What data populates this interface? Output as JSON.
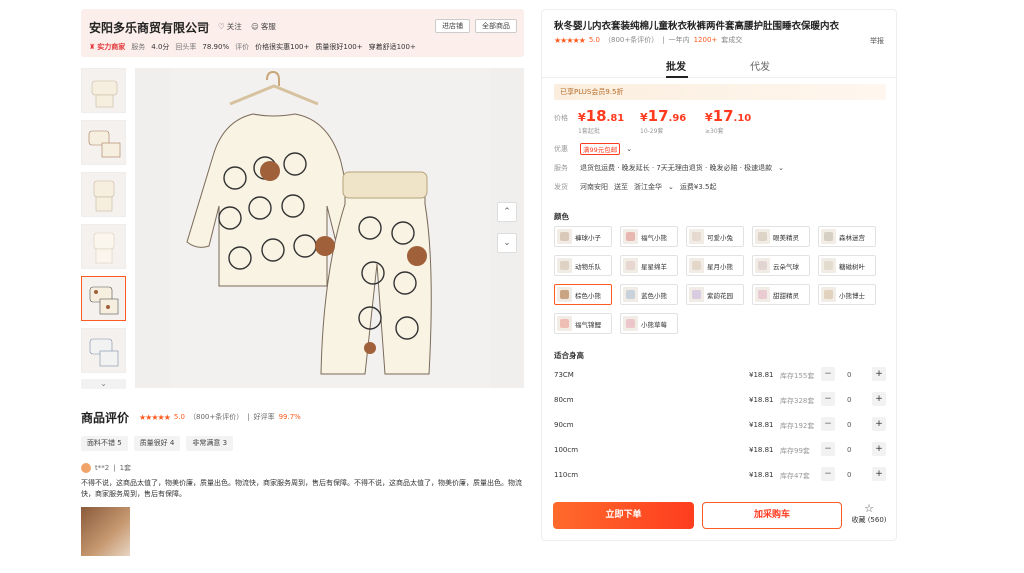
{
  "shop": {
    "name": "安阳多乐商贸有限公司",
    "follow_label": "关注",
    "cs_label": "客服",
    "enter_store": "进店铺",
    "all_products": "全部商品",
    "badge": "实力商家",
    "stats": [
      {
        "label": "服务",
        "value": "4.0分"
      },
      {
        "label": "回头率",
        "value": "78.90%"
      },
      {
        "label": "评价",
        "value": "价格很实惠100+"
      },
      {
        "label": "",
        "value": "质量很好100+"
      },
      {
        "label": "",
        "value": "穿着舒适100+"
      }
    ]
  },
  "gallery": {
    "up_arrow": "⌃",
    "down_arrow": "⌄",
    "thumb_down": "⌄"
  },
  "product": {
    "title": "秋冬婴儿内衣套装纯棉儿童秋衣秋裤两件套高腰护肚围睡衣保暖内衣",
    "stars": "★★★★★",
    "rating": "5.0",
    "rating_count": "（800+条评价）",
    "sales_prefix": "一年内",
    "sales_count": "1200+",
    "sales_suffix": "套成交",
    "report": "举报"
  },
  "tabs": [
    {
      "label": "批发"
    },
    {
      "label": "代发"
    }
  ],
  "plus_banner": "已享PLUS会员9.5折",
  "price": {
    "label": "价格",
    "tiers": [
      {
        "currency": "¥",
        "int": "18",
        "dec": ".81",
        "cond": "1套起批"
      },
      {
        "currency": "¥",
        "int": "17",
        "dec": ".96",
        "cond": "10-29套"
      },
      {
        "currency": "¥",
        "int": "17",
        "dec": ".10",
        "cond": "≥30套"
      }
    ]
  },
  "promo": {
    "label": "优惠",
    "coupon": "满99元包邮",
    "chevron": "⌄"
  },
  "service": {
    "label": "服务",
    "text": "退货包运费 · 晚发延长 · 7天无理由退货 · 晚发必赔 · 极速退款",
    "chevron": "⌄"
  },
  "shipping": {
    "label": "发货",
    "from": "河南安阳",
    "to_word": "送至",
    "to": "浙江金华",
    "chevron": "⌄",
    "fee": "运费¥3.5起"
  },
  "colors": {
    "label": "颜色",
    "options": [
      {
        "name": "褲球小子",
        "swatch": "#d9c9b8"
      },
      {
        "name": "福气小熊",
        "swatch": "#e8b8b0"
      },
      {
        "name": "可爱小兔",
        "swatch": "#e6d9cf"
      },
      {
        "name": "眼美精灵",
        "swatch": "#ddd3c6"
      },
      {
        "name": "森林迷宫",
        "swatch": "#d5cfc4"
      },
      {
        "name": "动物乐队",
        "swatch": "#ded2c4"
      },
      {
        "name": "星星绵羊",
        "swatch": "#e7d7d0"
      },
      {
        "name": "星月小熊",
        "swatch": "#e3d7c9"
      },
      {
        "name": "云朵气球",
        "swatch": "#e2d4d0"
      },
      {
        "name": "糖磁树叶",
        "swatch": "#e2dccf"
      },
      {
        "name": "棕色小熊",
        "swatch": "#c9a584"
      },
      {
        "name": "蓝色小熊",
        "swatch": "#c9d2da"
      },
      {
        "name": "紫韵花园",
        "swatch": "#d9cce0"
      },
      {
        "name": "甜甜精灵",
        "swatch": "#e9cbd2"
      },
      {
        "name": "小熊博士",
        "swatch": "#e1d2bd"
      },
      {
        "name": "福气锦鲤",
        "swatch": "#eebdb3"
      },
      {
        "name": "小熊草莓",
        "swatch": "#ecc6c8"
      }
    ]
  },
  "sizes": {
    "label": "适合身高",
    "rows": [
      {
        "name": "73CM",
        "price": "¥18.81",
        "stock": "库存155套",
        "qty": "0"
      },
      {
        "name": "80cm",
        "price": "¥18.81",
        "stock": "库存328套",
        "qty": "0"
      },
      {
        "name": "90cm",
        "price": "¥18.81",
        "stock": "库存192套",
        "qty": "0"
      },
      {
        "name": "100cm",
        "price": "¥18.81",
        "stock": "库存99套",
        "qty": "0"
      },
      {
        "name": "110cm",
        "price": "¥18.81",
        "stock": "库存47套",
        "qty": "0"
      }
    ]
  },
  "actions": {
    "buy_now": "立即下单",
    "add_cart": "加采购车",
    "fav_label": "收藏",
    "fav_count": "(560)"
  },
  "reviews": {
    "title": "商品评价",
    "stars": "★★★★★",
    "rating": "5.0",
    "count": "（800+条评价）",
    "good_rate_label": "好评率",
    "good_rate": "99.7%",
    "tags": [
      "面料不错 5",
      "质量很好 4",
      "非常满意 3"
    ],
    "user": "t**2",
    "qty": "1套",
    "text": "不得不说，这商品太值了，物美价廉，质量出色。物流快，商家服务周到，售后有保障。不得不说，这商品太值了，物美价廉，质量出色。物流快，商家服务周到，售后有保障。"
  }
}
